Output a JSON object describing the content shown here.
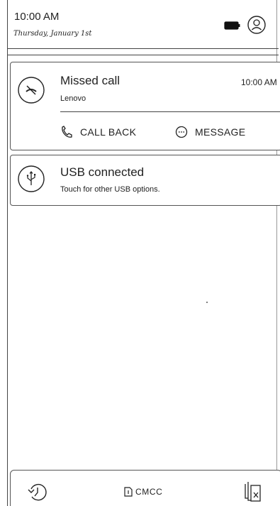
{
  "status": {
    "time": "10:00 AM",
    "date": "Thursday, January 1st"
  },
  "notifications": [
    {
      "icon": "missed-call-icon",
      "title": "Missed call",
      "subtitle": "Lenovo",
      "time": "10:00 AM",
      "actions": [
        {
          "icon": "phone-icon",
          "label": "CALL BACK"
        },
        {
          "icon": "message-icon",
          "label": "MESSAGE"
        }
      ]
    },
    {
      "icon": "usb-icon",
      "title": "USB connected",
      "subtitle": "Touch for other USB options."
    }
  ],
  "bottom_bar": {
    "carrier": "CMCC",
    "icons": [
      "history-icon",
      "sim-icon",
      "clear-all-icon"
    ]
  }
}
